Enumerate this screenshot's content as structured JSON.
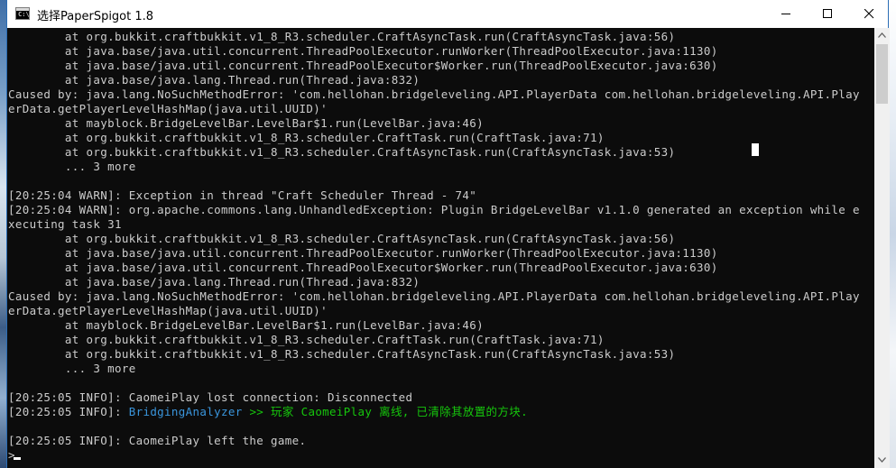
{
  "window": {
    "title": "选择PaperSpigot 1.8",
    "icon_label": "C:\\"
  },
  "controls": {
    "minimize": "minimize",
    "maximize": "maximize",
    "close": "close"
  },
  "colors": {
    "aqua": "#3a96dd",
    "green": "#13a10e",
    "text": "#cccccc",
    "background": "#0c0c0c"
  },
  "console": {
    "lines": [
      "        at org.bukkit.craftbukkit.v1_8_R3.scheduler.CraftAsyncTask.run(CraftAsyncTask.java:56)",
      "        at java.base/java.util.concurrent.ThreadPoolExecutor.runWorker(ThreadPoolExecutor.java:1130)",
      "        at java.base/java.util.concurrent.ThreadPoolExecutor$Worker.run(ThreadPoolExecutor.java:630)",
      "        at java.base/java.lang.Thread.run(Thread.java:832)",
      "Caused by: java.lang.NoSuchMethodError: 'com.hellohan.bridgeleveling.API.PlayerData com.hellohan.bridgeleveling.API.Play",
      "erData.getPlayerLevelHashMap(java.util.UUID)'",
      "        at mayblock.BridgeLevelBar.LevelBar$1.run(LevelBar.java:46)",
      "        at org.bukkit.craftbukkit.v1_8_R3.scheduler.CraftTask.run(CraftTask.java:71)",
      "        at org.bukkit.craftbukkit.v1_8_R3.scheduler.CraftAsyncTask.run(CraftAsyncTask.java:53)",
      "        ... 3 more",
      "",
      "[20:25:04 WARN]: Exception in thread \"Craft Scheduler Thread - 74\"",
      "[20:25:04 WARN]: org.apache.commons.lang.UnhandledException: Plugin BridgeLevelBar v1.1.0 generated an exception while e",
      "xecuting task 31",
      "        at org.bukkit.craftbukkit.v1_8_R3.scheduler.CraftAsyncTask.run(CraftAsyncTask.java:56)",
      "        at java.base/java.util.concurrent.ThreadPoolExecutor.runWorker(ThreadPoolExecutor.java:1130)",
      "        at java.base/java.util.concurrent.ThreadPoolExecutor$Worker.run(ThreadPoolExecutor.java:630)",
      "        at java.base/java.lang.Thread.run(Thread.java:832)",
      "Caused by: java.lang.NoSuchMethodError: 'com.hellohan.bridgeleveling.API.PlayerData com.hellohan.bridgeleveling.API.Play",
      "erData.getPlayerLevelHashMap(java.util.UUID)'",
      "        at mayblock.BridgeLevelBar.LevelBar$1.run(LevelBar.java:46)",
      "        at org.bukkit.craftbukkit.v1_8_R3.scheduler.CraftTask.run(CraftTask.java:71)",
      "        at org.bukkit.craftbukkit.v1_8_R3.scheduler.CraftAsyncTask.run(CraftAsyncTask.java:53)",
      "        ... 3 more",
      "",
      "[20:25:05 INFO]: CaomeiPlay lost connection: Disconnected"
    ],
    "colored_line": {
      "prefix": "[20:25:05 INFO]: ",
      "plugin": "BridgingAnalyzer",
      "message": " >> 玩家 CaomeiPlay 离线, 已清除其放置的方块."
    },
    "after_lines": [
      "",
      "[20:25:05 INFO]: CaomeiPlay left the game."
    ],
    "prompt": ">"
  }
}
